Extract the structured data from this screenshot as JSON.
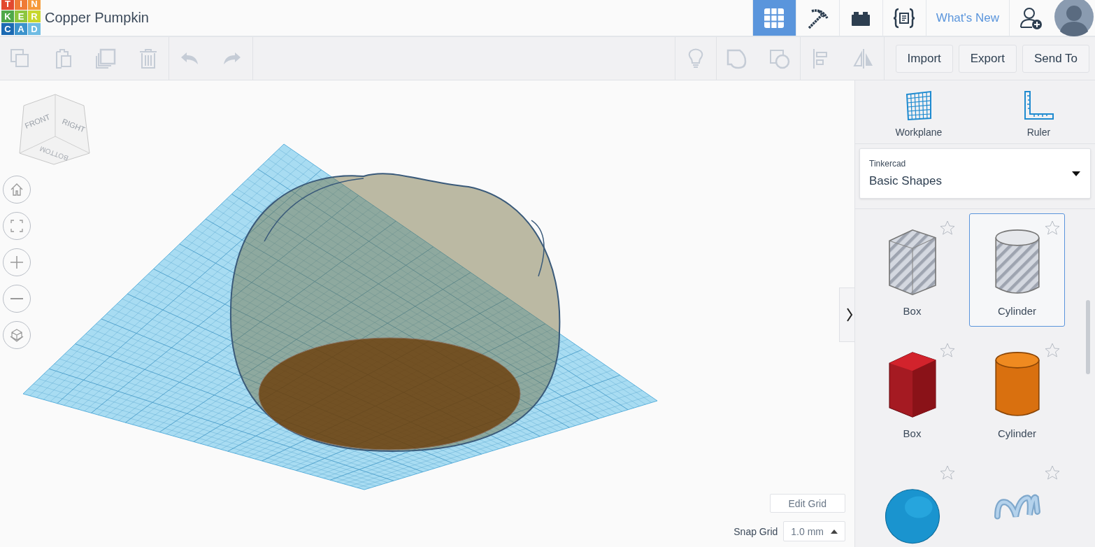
{
  "header": {
    "logo_letters": [
      "T",
      "I",
      "N",
      "K",
      "E",
      "R",
      "C",
      "A",
      "D"
    ],
    "title": "Copper Pumpkin",
    "nav": [
      {
        "kind": "grid",
        "selected": true
      },
      {
        "kind": "pickaxe",
        "selected": false
      },
      {
        "kind": "bricks",
        "selected": false
      },
      {
        "kind": "codeblocks",
        "selected": false
      }
    ],
    "whats_new": "What's New"
  },
  "toolbar": {
    "actions": [
      "Import",
      "Export",
      "Send To"
    ]
  },
  "view_cube": {
    "faces": [
      "FRONT",
      "RIGHT",
      "BOTTOM"
    ]
  },
  "grid_controls": {
    "edit_grid": "Edit Grid",
    "snap_label": "Snap Grid",
    "snap_value": "1.0 mm"
  },
  "panel": {
    "tools": [
      {
        "kind": "workplane",
        "label": "Workplane"
      },
      {
        "kind": "ruler",
        "label": "Ruler"
      }
    ],
    "library": {
      "source": "Tinkercad",
      "category": "Basic Shapes"
    },
    "shapes": [
      {
        "kind": "box-hole",
        "label": "Box",
        "selected": false
      },
      {
        "kind": "cylinder-hole",
        "label": "Cylinder",
        "selected": true
      },
      {
        "kind": "box",
        "label": "Box",
        "selected": false
      },
      {
        "kind": "cylinder",
        "label": "Cylinder",
        "selected": false
      },
      {
        "kind": "sphere",
        "selected": false
      },
      {
        "kind": "scribble",
        "selected": false
      }
    ]
  }
}
